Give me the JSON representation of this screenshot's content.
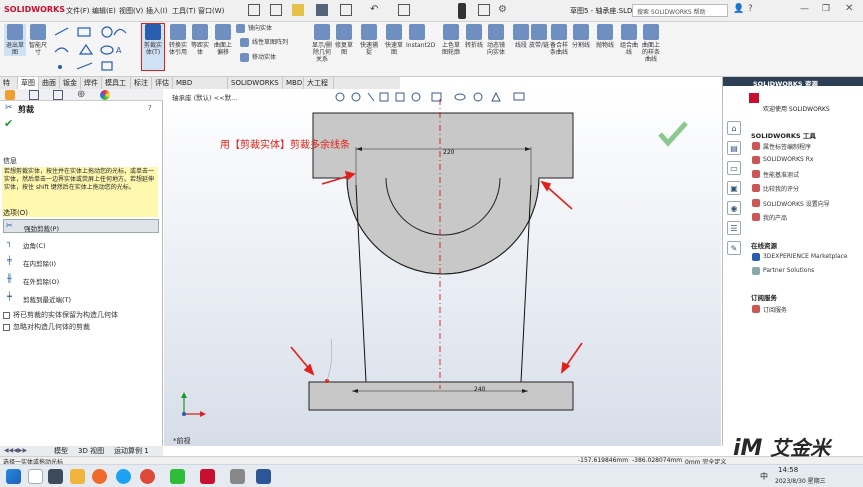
{
  "app": {
    "brand": "SOLIDWORKS",
    "doc_title": "草图5 - 轴承座.SLDPRT *",
    "search_placeholder": "搜索 SOLIDWORKS 帮助"
  },
  "menu": [
    "文件(F)",
    "编辑(E)",
    "视图(V)",
    "插入(I)",
    "工具(T)",
    "窗口(W)"
  ],
  "ribbon": [
    {
      "label": "退出草图",
      "active": true
    },
    {
      "label": "智能尺寸"
    },
    {
      "label": "剪裁实体(T)",
      "active": true,
      "highlight": true
    },
    {
      "label": "转换实体引用"
    },
    {
      "label": "等距实体"
    },
    {
      "label": "曲面上偏移"
    },
    {
      "label": "镜向实体"
    },
    {
      "label": "线性草图阵列"
    },
    {
      "label": "移动实体"
    },
    {
      "label": "显示/删除几何关系"
    },
    {
      "label": "修复草图"
    },
    {
      "label": "快速捕捉"
    },
    {
      "label": "快速草图"
    },
    {
      "label": "Instant2D"
    },
    {
      "label": "上色草图轮廓"
    },
    {
      "label": "转折线"
    },
    {
      "label": "动态镜向实体"
    },
    {
      "label": "线段"
    },
    {
      "label": "皮带/链"
    },
    {
      "label": "备合样条曲线"
    },
    {
      "label": "分割线"
    },
    {
      "label": "抛物线"
    },
    {
      "label": "组合曲线"
    },
    {
      "label": "曲面上的样条曲线"
    }
  ],
  "tabs": [
    "特征",
    "草图",
    "曲面",
    "钣金",
    "焊件",
    "模具工具",
    "标注",
    "评估",
    "MBD Dimensions",
    "SOLIDWORKS 插件",
    "MBD",
    "大工程师"
  ],
  "active_tab": "草图",
  "left_panel": {
    "title": "剪裁",
    "info_heading": "信息",
    "info_text": "若想剪裁实体，按住并在实体上拖动您的光标，或单击一实体，然后单击一边界实体或荧屏上任何地方。若想延伸实体，按住 shift 键然后在实体上拖动您的光标。",
    "options_heading": "选项(O)",
    "options": [
      "强劲剪裁(P)",
      "边角(C)",
      "在内剪除(I)",
      "在外剪除(O)",
      "剪裁到最近端(T)"
    ],
    "checkboxes": [
      "将已剪裁的实体保留为构造几何体",
      "忽略对构造几何体的剪裁"
    ]
  },
  "graphics": {
    "tree_label": "轴承座 (默认) <<默...",
    "annotation": "用【剪裁实体】剪裁多余线条",
    "dim_top": "220",
    "dim_bottom": "240",
    "view_label": "*前视"
  },
  "bottom_tabs": [
    "模型",
    "3D 视图",
    "运动算例 1"
  ],
  "status": {
    "hint": "选择一实体或拖动光标",
    "coords": [
      "-157.619846mm",
      "-386.028074mm",
      "0mm 完全定义"
    ]
  },
  "right_panel": {
    "header": "SOLIDWORKS 资源",
    "welcome": "欢迎使用 SOLIDWORKS",
    "tools_heading": "SOLIDWORKS 工具",
    "tools": [
      "属性标签编制程序",
      "SOLIDWORKS Rx",
      "性能基准测试",
      "比较我的评分",
      "SOLIDWORKS 设置向导",
      "我的产品"
    ],
    "online_heading": "在线资源",
    "online": [
      "3DEXPERIENCE Marketplace",
      "Partner Solutions"
    ],
    "sub_heading": "订阅服务",
    "sub": [
      "订阅服务"
    ]
  },
  "taskbar": {
    "time": "14:58",
    "date": "2023/8/30 星期三",
    "ime": "中"
  },
  "watermark": "艾金米",
  "colors": {
    "accent_red": "#e0201a",
    "sw_red": "#c8102e",
    "part_fill": "#c8c8c8"
  }
}
